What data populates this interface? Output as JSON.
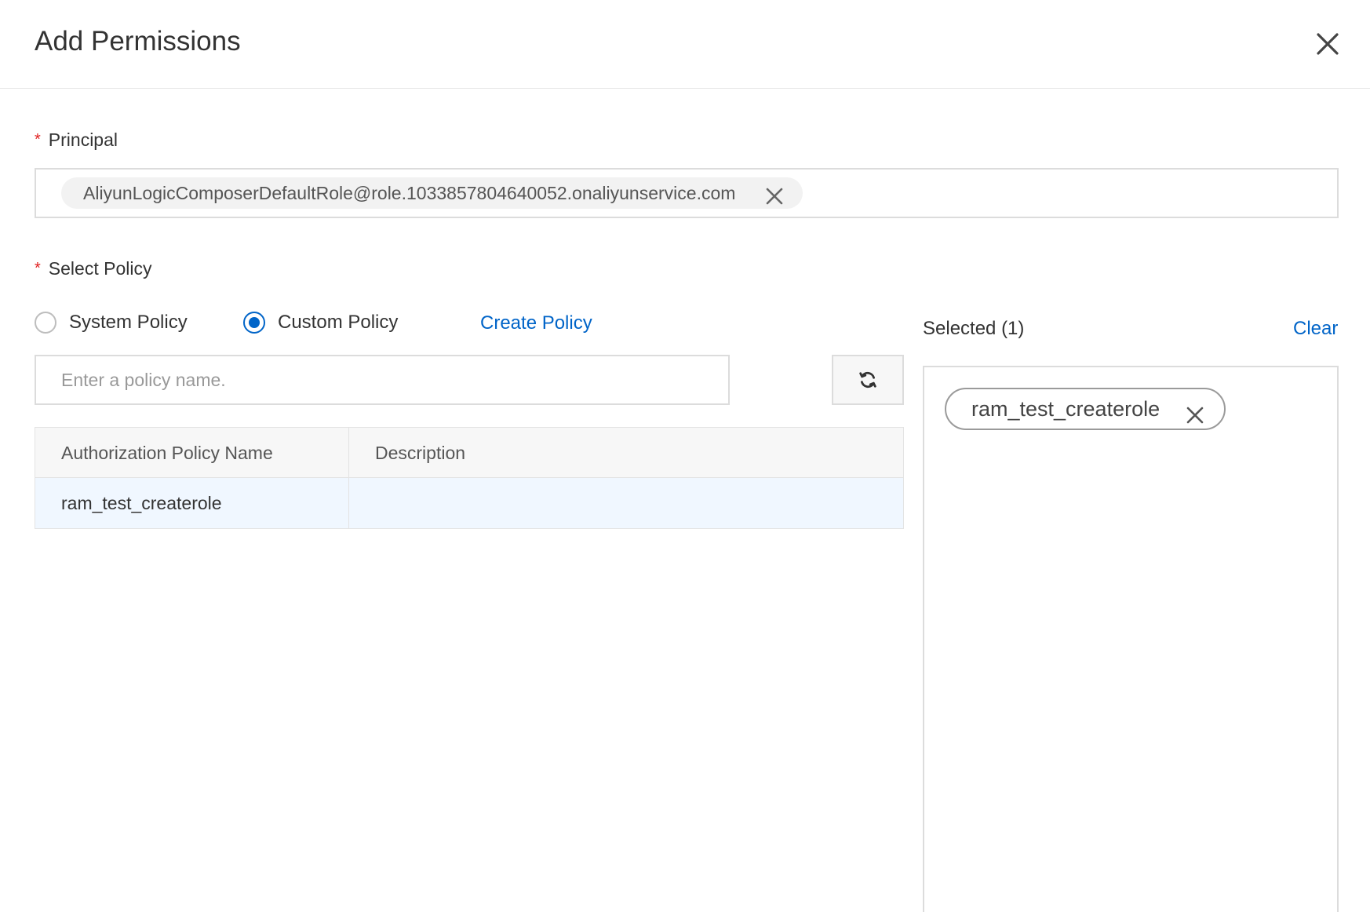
{
  "dialog": {
    "title": "Add Permissions"
  },
  "principal": {
    "label": "Principal",
    "required_mark": "*",
    "tag_value": "AliyunLogicComposerDefaultRole@role.1033857804640052.onaliyunservice.com"
  },
  "policy": {
    "label": "Select Policy",
    "required_mark": "*",
    "radio_options": [
      {
        "label": "System Policy",
        "checked": false
      },
      {
        "label": "Custom Policy",
        "checked": true
      }
    ],
    "create_link": "Create Policy",
    "search_placeholder": "Enter a policy name.",
    "search_value": "",
    "table": {
      "headers": [
        "Authorization Policy Name",
        "Description"
      ],
      "rows": [
        {
          "name": "ram_test_createrole",
          "description": "",
          "selected": true
        }
      ]
    }
  },
  "selected": {
    "label": "Selected (1)",
    "clear_link": "Clear",
    "items": [
      "ram_test_createrole"
    ]
  },
  "icons": {
    "close": "close-icon",
    "refresh": "refresh-icon",
    "tag_remove": "x-icon"
  },
  "colors": {
    "accent": "#0064c8",
    "required": "#e02020",
    "selected_row": "#f0f7ff",
    "border": "#dcdcdc"
  }
}
